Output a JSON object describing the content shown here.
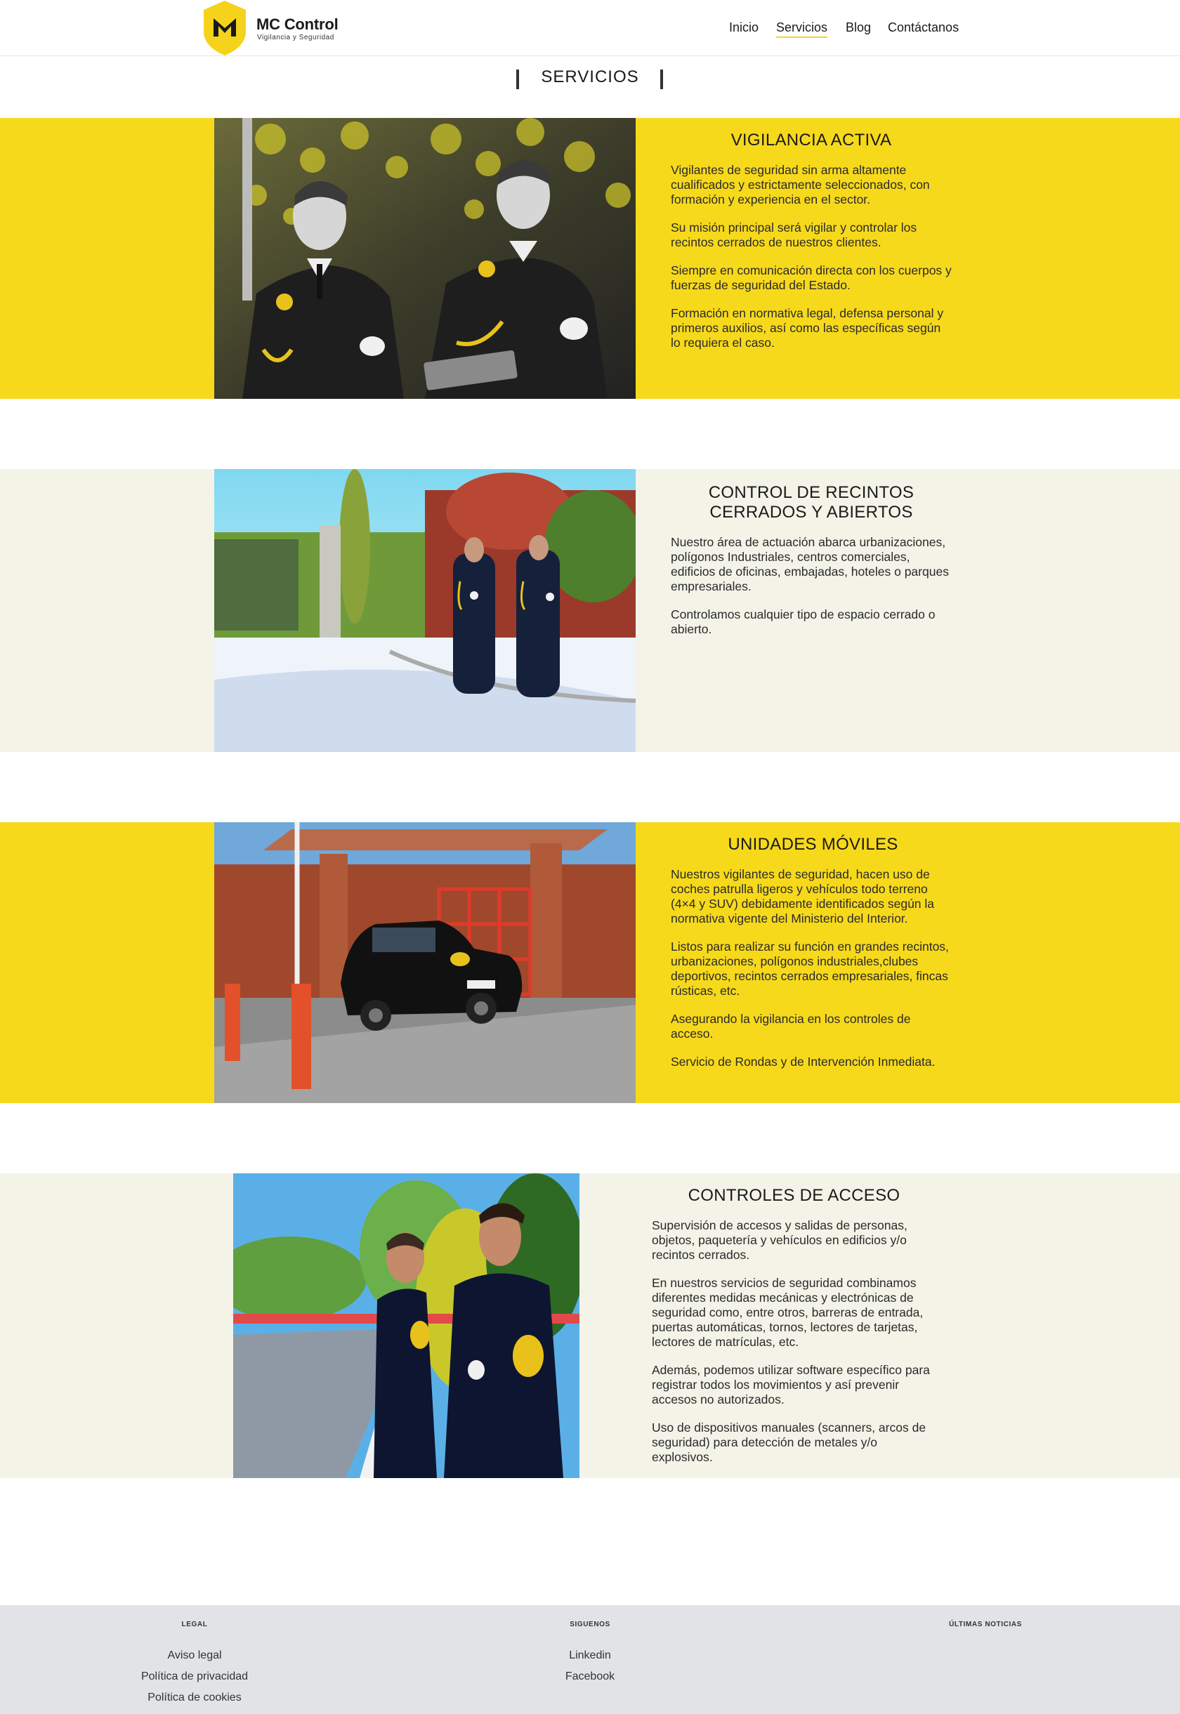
{
  "brand": {
    "name": "MC Control",
    "tagline": "Vigilancia y Seguridad"
  },
  "nav": {
    "items": [
      {
        "label": "Inicio"
      },
      {
        "label": "Servicios",
        "active": true
      },
      {
        "label": "Blog"
      },
      {
        "label": "Contáctanos"
      }
    ]
  },
  "page": {
    "title": "SERVICIOS"
  },
  "sections": [
    {
      "title": "VIGILANCIA ACTIVA",
      "background": "#f7d91c",
      "paragraphs": [
        "Vigilantes de seguridad sin arma altamente cualificados y estrictamente seleccionados, con formación y experiencia en el sector.",
        "Su misión principal será vigilar y controlar los recintos cerrados de nuestros clientes.",
        "Siempre en comunicación directa con los cuerpos y fuerzas de seguridad del Estado.",
        "Formación en normativa legal, defensa personal y primeros auxilios, así como las específicas según lo requiera el caso."
      ]
    },
    {
      "title": "CONTROL DE RECINTOS CERRADOS Y ABIERTOS",
      "background": "#f3f3e8",
      "paragraphs": [
        "Nuestro área de actuación abarca urbanizaciones, polígonos Industriales, centros comerciales, edificios de oficinas, embajadas, hoteles o parques empresariales.",
        "Controlamos cualquier tipo de espacio cerrado o abierto."
      ]
    },
    {
      "title": "UNIDADES MÓVILES",
      "background": "#f7d91c",
      "paragraphs": [
        "Nuestros vigilantes de seguridad, hacen uso de coches patrulla ligeros y vehículos todo terreno (4×4 y SUV) debidamente identificados según la normativa vigente del Ministerio del Interior.",
        "Listos para realizar su función en grandes recintos, urbanizaciones, polígonos industriales,clubes deportivos, recintos cerrados empresariales, fincas rústicas, etc.",
        "Asegurando la vigilancia en los controles de acceso.",
        "Servicio de Rondas y de Intervención Inmediata."
      ]
    },
    {
      "title": "CONTROLES DE ACCESO",
      "background": "#f3f3e8",
      "paragraphs": [
        "Supervisión de accesos y salidas de personas, objetos, paquetería y vehículos en edificios y/o recintos cerrados.",
        "En nuestros servicios de seguridad combinamos diferentes medidas mecánicas y electrónicas de seguridad como, entre otros, barreras de entrada, puertas automáticas, tornos, lectores de tarjetas, lectores de matrículas, etc.",
        "Además, podemos utilizar software específico para registrar todos los movimientos y así prevenir accesos no autorizados.",
        "Uso de dispositivos manuales (scanners, arcos de seguridad) para detección de metales y/o explosivos."
      ]
    }
  ],
  "footer": {
    "legal": {
      "heading": "LEGAL",
      "links": [
        "Aviso legal",
        "Política de privacidad",
        "Política de cookies"
      ]
    },
    "social": {
      "heading": "SIGUENOS",
      "links": [
        "Linkedin",
        "Facebook"
      ]
    },
    "news": {
      "heading": "ÚLTIMAS NOTICIAS"
    }
  },
  "colors": {
    "accent": "#f7d91c",
    "cream": "#f3f3e8",
    "footer": "#e2e3e6"
  }
}
